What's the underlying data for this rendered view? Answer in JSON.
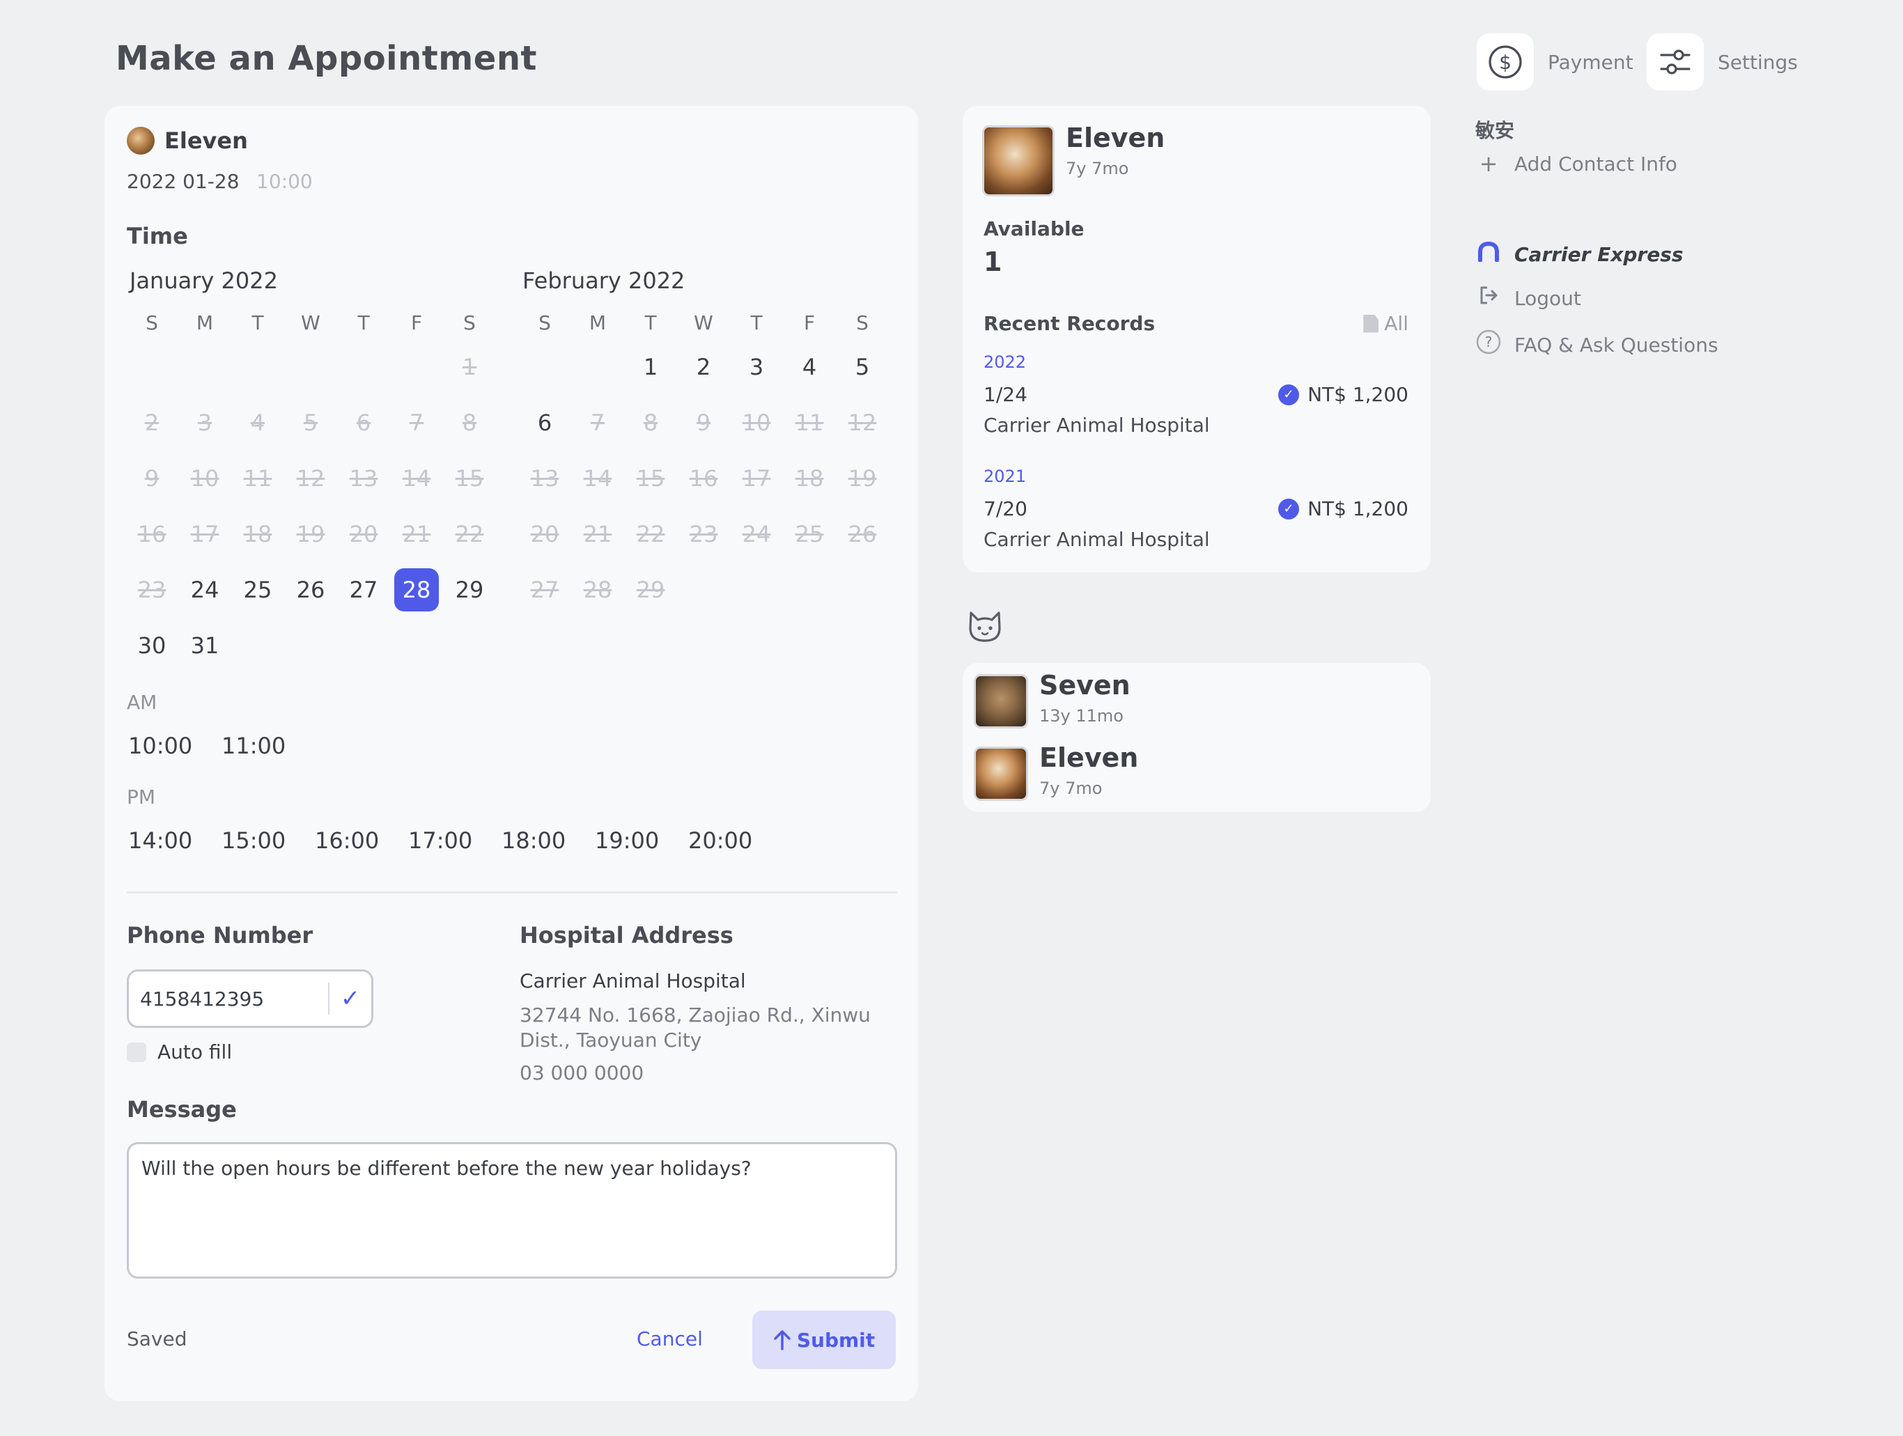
{
  "page": {
    "title": "Make an Appointment"
  },
  "form": {
    "pet_name": "Eleven",
    "date": "2022 01-28",
    "time": "10:00",
    "time_label": "Time",
    "months": [
      {
        "title": "January 2022",
        "dow": [
          "S",
          "M",
          "T",
          "W",
          "T",
          "F",
          "S"
        ],
        "weeks": [
          [
            {
              "d": ""
            },
            {
              "d": ""
            },
            {
              "d": ""
            },
            {
              "d": ""
            },
            {
              "d": ""
            },
            {
              "d": ""
            },
            {
              "d": "1",
              "s": "disabled"
            }
          ],
          [
            {
              "d": "2",
              "s": "disabled"
            },
            {
              "d": "3",
              "s": "disabled"
            },
            {
              "d": "4",
              "s": "disabled"
            },
            {
              "d": "5",
              "s": "disabled"
            },
            {
              "d": "6",
              "s": "disabled"
            },
            {
              "d": "7",
              "s": "disabled"
            },
            {
              "d": "8",
              "s": "disabled"
            }
          ],
          [
            {
              "d": "9",
              "s": "disabled"
            },
            {
              "d": "10",
              "s": "disabled"
            },
            {
              "d": "11",
              "s": "disabled"
            },
            {
              "d": "12",
              "s": "disabled"
            },
            {
              "d": "13",
              "s": "disabled"
            },
            {
              "d": "14",
              "s": "disabled"
            },
            {
              "d": "15",
              "s": "disabled"
            }
          ],
          [
            {
              "d": "16",
              "s": "disabled"
            },
            {
              "d": "17",
              "s": "disabled"
            },
            {
              "d": "18",
              "s": "disabled"
            },
            {
              "d": "19",
              "s": "disabled"
            },
            {
              "d": "20",
              "s": "disabled"
            },
            {
              "d": "21",
              "s": "disabled"
            },
            {
              "d": "22",
              "s": "disabled"
            }
          ],
          [
            {
              "d": "23",
              "s": "disabled"
            },
            {
              "d": "24"
            },
            {
              "d": "25"
            },
            {
              "d": "26"
            },
            {
              "d": "27"
            },
            {
              "d": "28",
              "s": "selected"
            },
            {
              "d": "29"
            }
          ],
          [
            {
              "d": "30"
            },
            {
              "d": "31"
            },
            {
              "d": ""
            },
            {
              "d": ""
            },
            {
              "d": ""
            },
            {
              "d": ""
            },
            {
              "d": ""
            }
          ]
        ]
      },
      {
        "title": "February 2022",
        "dow": [
          "S",
          "M",
          "T",
          "W",
          "T",
          "F",
          "S"
        ],
        "weeks": [
          [
            {
              "d": ""
            },
            {
              "d": ""
            },
            {
              "d": "1"
            },
            {
              "d": "2"
            },
            {
              "d": "3"
            },
            {
              "d": "4"
            },
            {
              "d": "5"
            }
          ],
          [
            {
              "d": "6"
            },
            {
              "d": "7",
              "s": "disabled"
            },
            {
              "d": "8",
              "s": "disabled"
            },
            {
              "d": "9",
              "s": "disabled"
            },
            {
              "d": "10",
              "s": "disabled"
            },
            {
              "d": "11",
              "s": "disabled"
            },
            {
              "d": "12",
              "s": "disabled"
            }
          ],
          [
            {
              "d": "13",
              "s": "disabled"
            },
            {
              "d": "14",
              "s": "disabled"
            },
            {
              "d": "15",
              "s": "disabled"
            },
            {
              "d": "16",
              "s": "disabled"
            },
            {
              "d": "17",
              "s": "disabled"
            },
            {
              "d": "18",
              "s": "disabled"
            },
            {
              "d": "19",
              "s": "disabled"
            }
          ],
          [
            {
              "d": "20",
              "s": "disabled"
            },
            {
              "d": "21",
              "s": "disabled"
            },
            {
              "d": "22",
              "s": "disabled"
            },
            {
              "d": "23",
              "s": "disabled"
            },
            {
              "d": "24",
              "s": "disabled"
            },
            {
              "d": "25",
              "s": "disabled"
            },
            {
              "d": "26",
              "s": "disabled"
            }
          ],
          [
            {
              "d": "27",
              "s": "disabled"
            },
            {
              "d": "28",
              "s": "disabled"
            },
            {
              "d": "29",
              "s": "disabled"
            },
            {
              "d": ""
            },
            {
              "d": ""
            },
            {
              "d": ""
            },
            {
              "d": ""
            }
          ]
        ]
      }
    ],
    "am_label": "AM",
    "am_slots": [
      "10:00",
      "11:00"
    ],
    "pm_label": "PM",
    "pm_slots": [
      "14:00",
      "15:00",
      "16:00",
      "17:00",
      "18:00",
      "19:00",
      "20:00"
    ],
    "phone_label": "Phone Number",
    "phone_value": "4158412395",
    "autofill_label": "Auto fill",
    "hospital_label": "Hospital Address",
    "hospital_name": "Carrier Animal Hospital",
    "hospital_address": "32744 No. 1668, Zaojiao Rd., Xinwu Dist., Taoyuan City",
    "hospital_phone": "03 000 0000",
    "message_label": "Message",
    "message_value": "Will the open hours be different before the new year holidays?",
    "status": "Saved",
    "cancel_label": "Cancel",
    "submit_label": "Submit"
  },
  "profile": {
    "name": "Eleven",
    "age": "7y 7mo",
    "available_label": "Available",
    "available_value": "1",
    "recent_label": "Recent Records",
    "all_label": "All",
    "records": [
      {
        "year": "2022",
        "date": "1/24",
        "price": "NT$ 1,200",
        "hospital": "Carrier Animal Hospital"
      },
      {
        "year": "2021",
        "date": "7/20",
        "price": "NT$ 1,200",
        "hospital": "Carrier Animal Hospital"
      }
    ]
  },
  "pets": [
    {
      "name": "Seven",
      "age": "13y 11mo"
    },
    {
      "name": "Eleven",
      "age": "7y 7mo"
    }
  ],
  "sidebar": {
    "payment_label": "Payment",
    "settings_label": "Settings",
    "user_name": "敏安",
    "add_contact": "Add Contact Info",
    "brand": "Carrier Express",
    "logout": "Logout",
    "faq": "FAQ & Ask Questions"
  },
  "colors": {
    "accent": "#4f5be8",
    "background": "#eff0f2",
    "card": "#f8f9fb"
  }
}
